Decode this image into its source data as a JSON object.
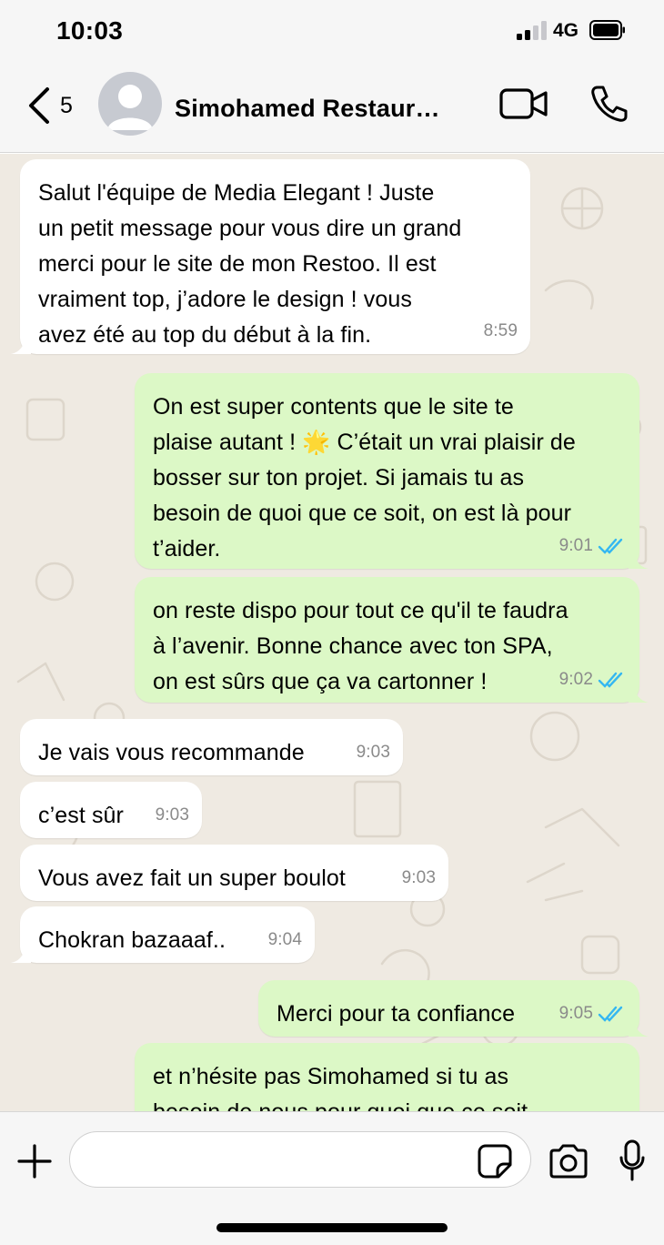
{
  "status_bar": {
    "time": "10:03",
    "network": "4G",
    "icons": [
      "signal-icon",
      "battery-icon"
    ]
  },
  "header": {
    "back_count": "5",
    "contact_name": "Simohamed Restaurant",
    "icons": [
      "chevron-left-icon",
      "avatar-placeholder-icon",
      "video-call-icon",
      "phone-call-icon"
    ]
  },
  "messages": [
    {
      "direction": "in",
      "text": "Salut l'équipe de Media Elegant ! Juste\nun petit message pour vous dire un grand\nmerci pour le site de mon Restoo. Il est\nvraiment top, j’adore le design ! vous\navez été au top du début à la fin.",
      "time": "8:59"
    },
    {
      "direction": "out",
      "text": "On est super contents que le site te\nplaise autant ! 🌟 C’était un vrai plaisir de\nbosser sur ton projet. Si jamais tu as\nbesoin de quoi que ce soit, on est là pour\nt’aider.",
      "time": "9:01",
      "read": true
    },
    {
      "direction": "out",
      "text": "on reste dispo pour tout ce qu'il te faudra\nà l’avenir. Bonne chance avec ton SPA,\non est sûrs que ça va cartonner !",
      "time": "9:02",
      "read": true
    },
    {
      "direction": "in",
      "text": "Je vais vous recommande",
      "time": "9:03"
    },
    {
      "direction": "in",
      "text": "c’est sûr",
      "time": "9:03"
    },
    {
      "direction": "in",
      "text": "Vous avez fait un super boulot",
      "time": "9:03"
    },
    {
      "direction": "in",
      "text": "Chokran bazaaaf..",
      "time": "9:04"
    },
    {
      "direction": "out",
      "text": "Merci pour ta confiance",
      "time": "9:05",
      "read": true
    },
    {
      "direction": "out",
      "text": "et n’hésite pas Simohamed si tu as\nbesoin de nous pour quoi que ce soit",
      "time": "",
      "read": false
    }
  ],
  "colors": {
    "incoming_bubble": "#ffffff",
    "outgoing_bubble": "#dcf8c6",
    "chat_background": "#efeae2",
    "read_ticks": "#34b7f1"
  },
  "input": {
    "placeholder": "",
    "value": ""
  },
  "input_icons": [
    "plus-icon",
    "sticker-icon",
    "camera-icon",
    "microphone-icon"
  ]
}
